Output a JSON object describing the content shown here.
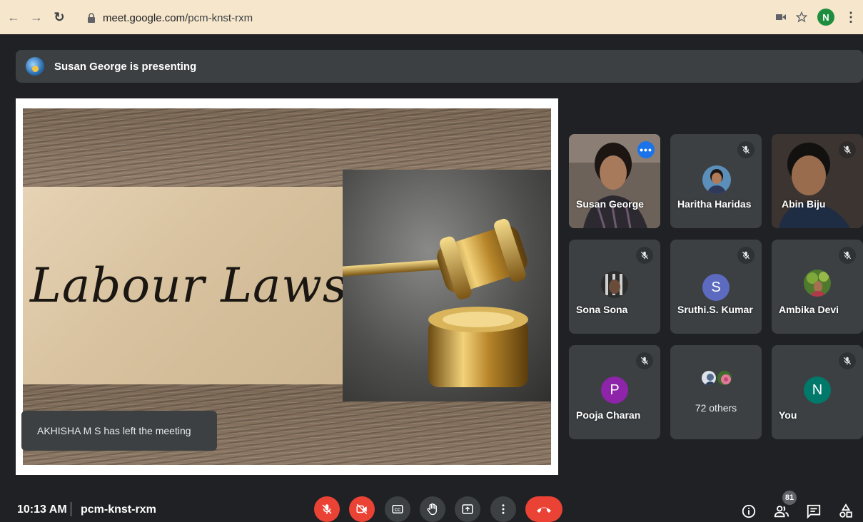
{
  "browser": {
    "url_host": "meet.google.com",
    "url_path": "/pcm-knst-rxm",
    "profile_initial": "N"
  },
  "presenting": {
    "text": "Susan George is presenting"
  },
  "slide": {
    "title": "Labour Laws"
  },
  "notification": {
    "text": "AKHISHA M S has left the meeting"
  },
  "participants": [
    {
      "name": "Susan George",
      "muted": false,
      "active": true
    },
    {
      "name": "Haritha Haridas",
      "muted": true
    },
    {
      "name": "Abin Biju",
      "muted": true
    },
    {
      "name": "Sona Sona",
      "muted": true
    },
    {
      "name": "Sruthi.S. Kumar",
      "muted": true,
      "initial": "S",
      "color": "#5c6bc0"
    },
    {
      "name": "Ambika Devi",
      "muted": true
    },
    {
      "name": "Pooja Charan",
      "muted": true,
      "initial": "P",
      "color": "#8e24aa"
    },
    {
      "name": "72 others"
    },
    {
      "name": "You",
      "muted": true,
      "initial": "N",
      "color": "#00796b"
    }
  ],
  "bottom_bar": {
    "time": "10:13 AM",
    "meeting_code": "pcm-knst-rxm",
    "participant_count": "81"
  },
  "colors": {
    "red": "#ea4335",
    "dark": "#202124",
    "tile": "#3c4043",
    "accent": "#8ab4f8"
  }
}
